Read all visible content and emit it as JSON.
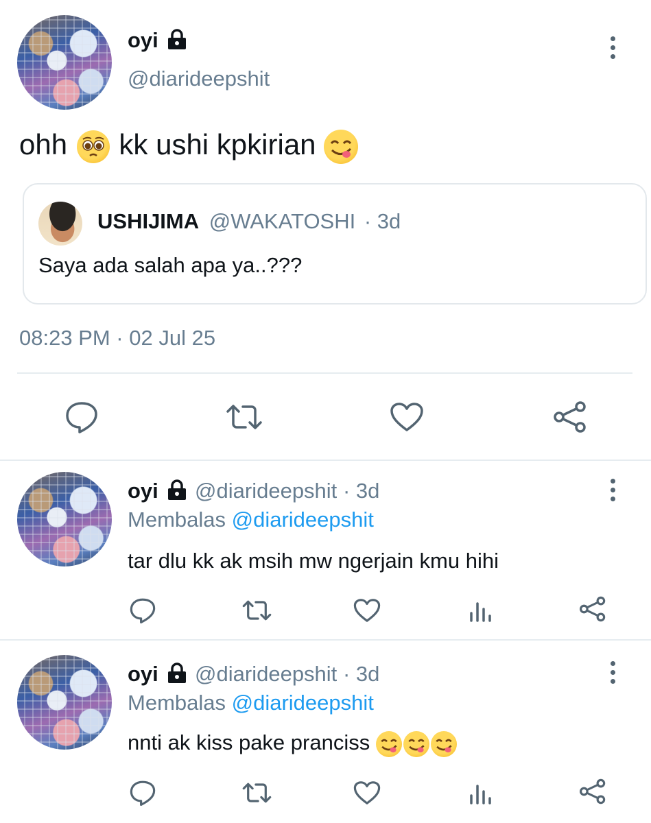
{
  "main_tweet": {
    "display_name": "oyi",
    "handle": "@diarideepshit",
    "text_parts": [
      "ohh ",
      " kk ushi kpkirian "
    ],
    "timestamp": "08:23 PM · 02 Jul 25",
    "icons": [
      "lock-icon",
      "more-vertical-icon",
      "pleading-face-emoji",
      "yum-face-emoji"
    ],
    "quoted": {
      "display_name": "USHIJIMA",
      "handle": "@WAKATOSHI",
      "age": "· 3d",
      "text": "Saya ada salah apa ya..???"
    },
    "actions": [
      "reply-icon",
      "retweet-icon",
      "like-icon",
      "share-icon"
    ]
  },
  "replies": [
    {
      "display_name": "oyi",
      "handle": "@diarideepshit",
      "age": "· 3d",
      "reply_prefix": "Membalas ",
      "reply_to": "@diarideepshit",
      "text": "tar dlu kk ak msih mw ngerjain kmu hihi",
      "actions": [
        "reply-icon",
        "retweet-icon",
        "like-icon",
        "analytics-icon",
        "share-icon"
      ]
    },
    {
      "display_name": "oyi",
      "handle": "@diarideepshit",
      "age": "· 3d",
      "reply_prefix": "Membalas ",
      "reply_to": "@diarideepshit",
      "text": "nnti ak kiss pake pranciss ",
      "actions": [
        "reply-icon",
        "retweet-icon",
        "like-icon",
        "analytics-icon",
        "share-icon"
      ]
    }
  ],
  "colors": {
    "text": "#0f1419",
    "muted": "#677d90",
    "link": "#1d9bf0",
    "divider": "#e6ecf0",
    "icon": "#536471"
  }
}
